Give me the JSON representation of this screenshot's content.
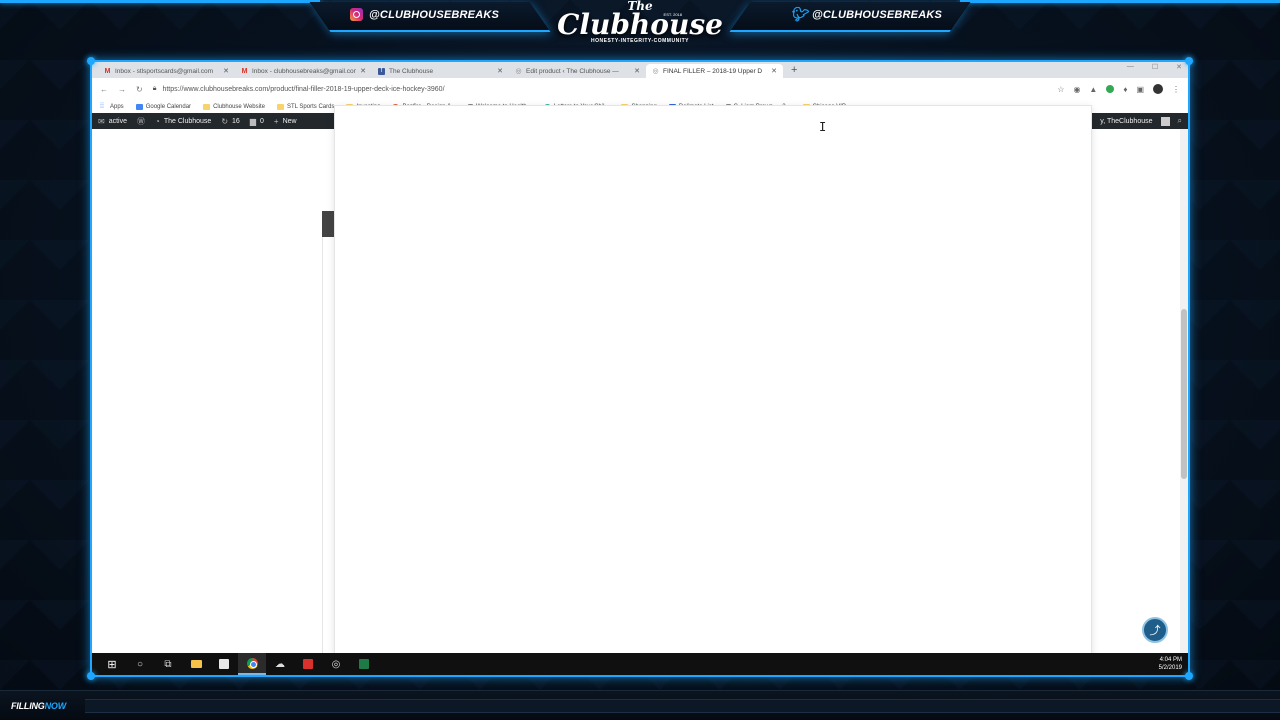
{
  "overlay": {
    "instagram_handle": "@CLUBHOUSEBREAKS",
    "twitter_handle": "@CLUBHOUSEBREAKS",
    "logo_the": "The",
    "logo_name": "Clubhouse",
    "logo_tagline": "HONESTY-INTEGRITY-COMMUNITY",
    "logo_est": "EST. 2018",
    "ticker_label_a": "FILLING",
    "ticker_label_b": "NOW",
    "accent_color": "#1ea7ff"
  },
  "browser": {
    "tabs": [
      {
        "icon": "gmail-icon",
        "label": "Inbox - stlsportscards@gmail.com",
        "active": false
      },
      {
        "icon": "gmail-icon",
        "label": "Inbox - clubhousebreaks@gmail.com",
        "active": false
      },
      {
        "icon": "facebook-icon",
        "label": "The Clubhouse",
        "active": false
      },
      {
        "icon": "globe-icon",
        "label": "Edit product ‹ The Clubhouse —",
        "active": false
      },
      {
        "icon": "globe-icon",
        "label": "FINAL FILLER – 2018-19 Upper D",
        "active": true
      }
    ],
    "new_tab": "+",
    "url": "https://www.clubhousebreaks.com/product/final-filler-2018-19-upper-deck-ice-hockey-3960/",
    "bookmarks": [
      "Apps",
      "Google Calendar",
      "Clubhouse Website",
      "STL Sports Cards",
      "Investing",
      "Bonfire - Design &...",
      "Welcome to Health...",
      "Letters to Your Chil...",
      "Shopping",
      "Delimate List",
      "C. Liam Brown — 2...",
      "Chicago VIP"
    ]
  },
  "wp_admin": {
    "active": "active",
    "site_name": "The Clubhouse",
    "updates": "16",
    "comments": "0",
    "new": "New",
    "howdy": "y, TheClubhouse"
  },
  "taskbar": {
    "time": "4:04 PM",
    "date": "5/2/2019"
  }
}
